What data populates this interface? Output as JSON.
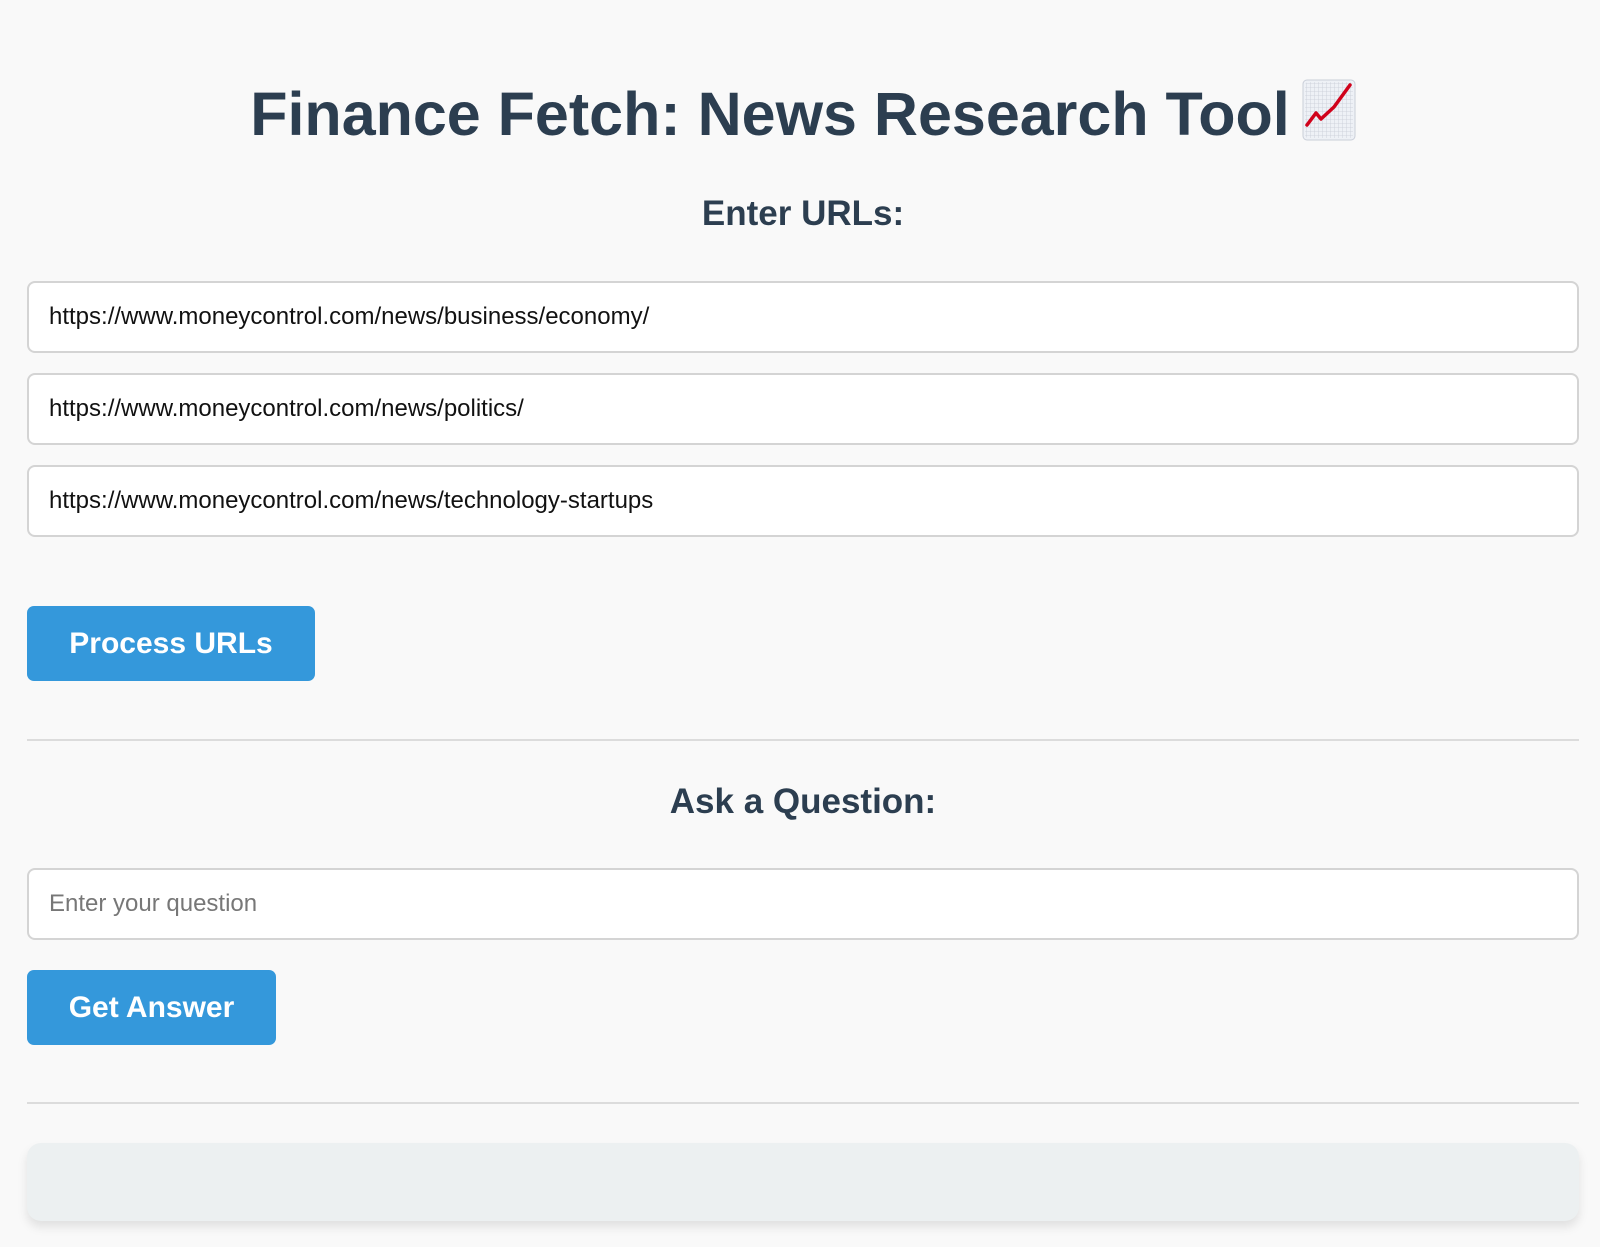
{
  "header": {
    "title": "Finance Fetch: News Research Tool",
    "title_icon": "chart-increasing-icon"
  },
  "urls_section": {
    "heading": "Enter URLs:",
    "inputs": [
      "https://www.moneycontrol.com/news/business/economy/",
      "https://www.moneycontrol.com/news/politics/",
      "https://www.moneycontrol.com/news/technology-startups"
    ],
    "process_button_label": "Process URLs"
  },
  "question_section": {
    "heading": "Ask a Question:",
    "placeholder": "Enter your question",
    "value": "",
    "answer_button_label": "Get Answer"
  },
  "answer": {
    "text": ""
  },
  "colors": {
    "primary": "#3498db",
    "heading": "#2c3e50",
    "answer_bg": "#ecf0f1",
    "icon_line": "#d0021b"
  }
}
